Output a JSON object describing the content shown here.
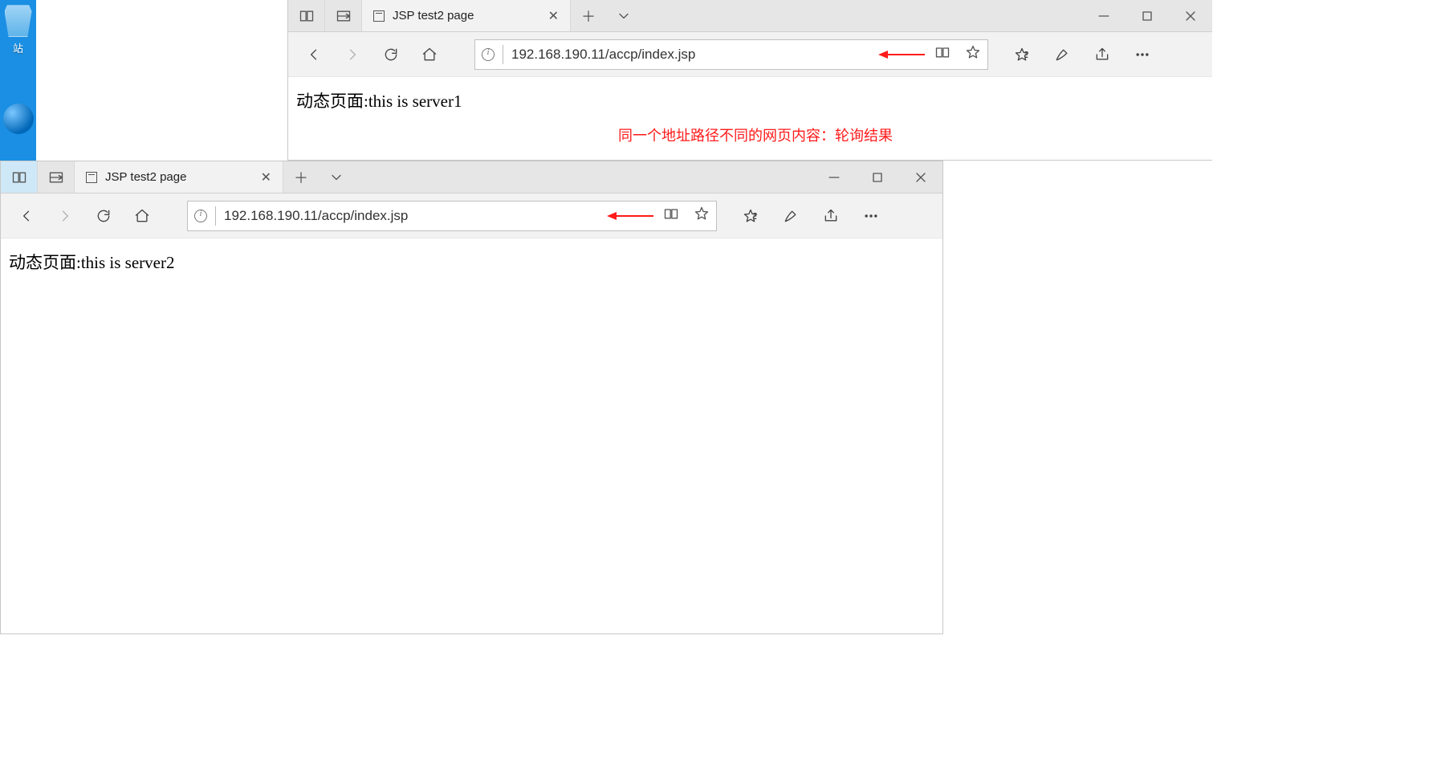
{
  "desktop": {
    "recycle_label": "站"
  },
  "annotation": "同一个地址路径不同的网页内容：轮询结果",
  "win1": {
    "tab_title": "JSP test2 page",
    "url": "192.168.190.11/accp/index.jsp",
    "page_text": "动态页面:this is server1"
  },
  "win2": {
    "tab_title": "JSP test2 page",
    "url": "192.168.190.11/accp/index.jsp",
    "page_text": "动态页面:this is server2"
  }
}
